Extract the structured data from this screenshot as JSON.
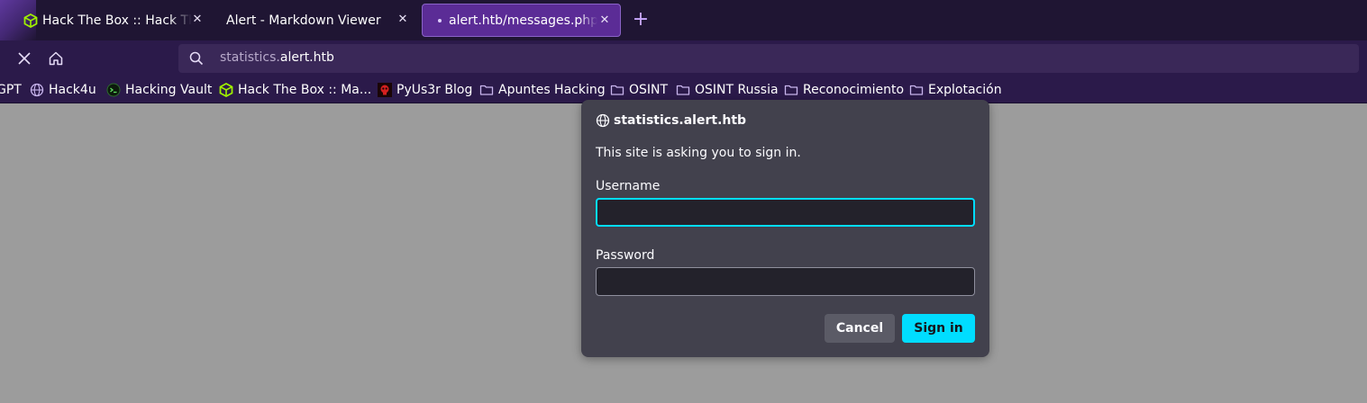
{
  "tabs": [
    {
      "title": "Hack The Box :: Hack The Box",
      "icon": "hackthebox-icon",
      "active": false
    },
    {
      "title": "Alert - Markdown Viewer",
      "icon": "",
      "active": false
    },
    {
      "title": "alert.htb/messages.php?file=",
      "icon": "dot-icon",
      "active": true
    }
  ],
  "tab_close_glyph": "✕",
  "new_tab_glyph": "+",
  "urlbar": {
    "url_prefix": "statistics.",
    "url_domain": "alert.htb"
  },
  "bookmarks": [
    {
      "label": "GPT",
      "icon": ""
    },
    {
      "label": "Hack4u",
      "icon": "globe-icon"
    },
    {
      "label": "Hacking Vault",
      "icon": "terminal-icon"
    },
    {
      "label": "Hack The Box :: Ma...",
      "icon": "hackthebox-icon"
    },
    {
      "label": "PyUs3r Blog",
      "icon": "skull-icon"
    },
    {
      "label": "Apuntes Hacking",
      "icon": "folder-icon"
    },
    {
      "label": "OSINT",
      "icon": "folder-icon"
    },
    {
      "label": "OSINT Russia",
      "icon": "folder-icon"
    },
    {
      "label": "Reconocimiento",
      "icon": "folder-icon"
    },
    {
      "label": "Explotación",
      "icon": "folder-icon"
    }
  ],
  "dialog": {
    "site": "statistics.alert.htb",
    "message": "This site is asking you to sign in.",
    "username_label": "Username",
    "username_value": "",
    "password_label": "Password",
    "password_value": "",
    "cancel_label": "Cancel",
    "signin_label": "Sign in"
  },
  "colors": {
    "accent": "#00ddff",
    "tab_active": "#5b2c96",
    "toolbar": "#2b1a4a",
    "page_background": "#9c9c9c"
  }
}
